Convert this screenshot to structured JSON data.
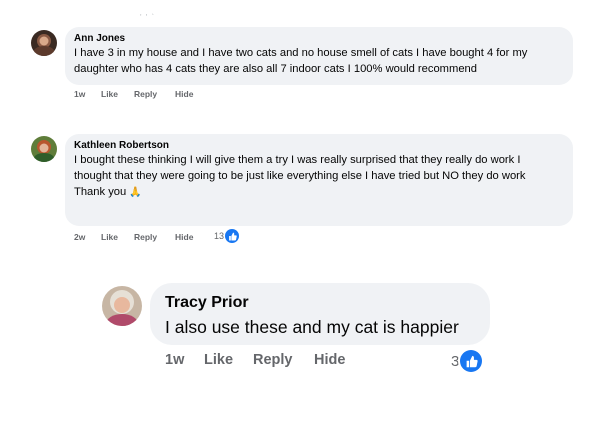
{
  "comments": [
    {
      "author": "Ann Jones",
      "text": "I have 3 in my house and I have two cats and no house smell of cats I have bought 4 for my daughter who has 4 cats they are also all 7 indoor cats I 100% would recommend",
      "time": "1w",
      "like_label": "Like",
      "reply_label": "Reply",
      "hide_label": "Hide"
    },
    {
      "author": "Kathleen Robertson",
      "text_line1": "I bought these thinking I will give them a try I was really surprised that they really do work I thought that they were going to be just like everything else I have tried but NO they do work",
      "text_line2": "Thank you",
      "emoji": "🙏",
      "time": "2w",
      "like_label": "Like",
      "reply_label": "Reply",
      "hide_label": "Hide",
      "reaction_count": "13"
    },
    {
      "author": "Tracy Prior",
      "text": "I also use these and my cat is happier",
      "time": "1w",
      "like_label": "Like",
      "reply_label": "Reply",
      "hide_label": "Hide",
      "reaction_count": "3"
    }
  ],
  "icons": {
    "like": "thumbs-up-icon"
  },
  "colors": {
    "bubble": "#f0f2f5",
    "action_text": "#65676b",
    "like_blue": "#1877f2"
  }
}
